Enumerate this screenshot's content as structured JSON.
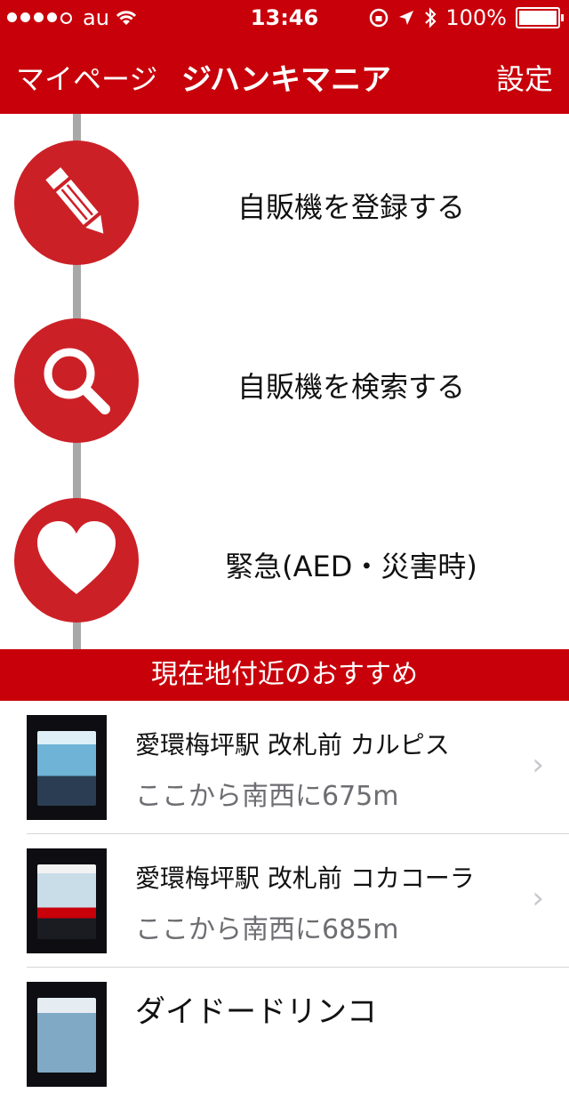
{
  "status_bar": {
    "carrier": "au",
    "time": "13:46",
    "battery": "100%"
  },
  "nav": {
    "left": "マイページ",
    "title": "ジハンキマニア",
    "right": "設定"
  },
  "menu": [
    {
      "label": "自販機を登録する",
      "icon": "pencil-icon"
    },
    {
      "label": "自販機を検索する",
      "icon": "search-icon"
    },
    {
      "label": "緊急(AED・災害時)",
      "icon": "heart-icon"
    }
  ],
  "recommend_header": "現在地付近のおすすめ",
  "list": [
    {
      "name": "愛環梅坪駅 改札前 カルピス",
      "distance": "ここから南西に675m"
    },
    {
      "name": "愛環梅坪駅 改札前 コカコーラ",
      "distance": "ここから南西に685m"
    },
    {
      "name": "ダイドードリンコ",
      "distance": ""
    }
  ],
  "colors": {
    "brand_red": "#c8000a",
    "icon_red": "#cc2027"
  }
}
